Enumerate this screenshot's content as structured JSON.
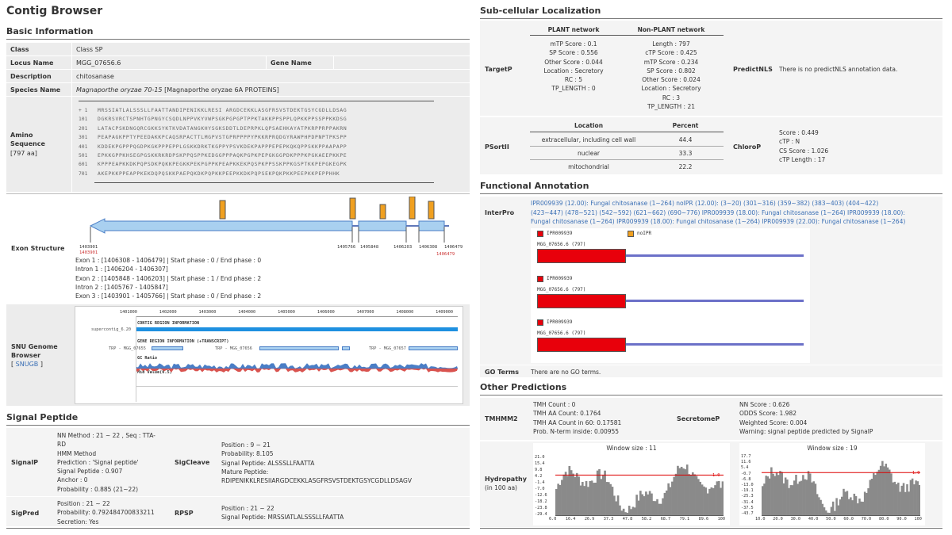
{
  "page_title": "Contig Browser",
  "sections": {
    "basic": "Basic Information",
    "signal": "Signal Peptide",
    "subcell": "Sub-cellular Localization",
    "functional": "Functional Annotation",
    "other": "Other Predictions"
  },
  "basic": {
    "class_label": "Class",
    "class_value": "Class SP",
    "locus_label": "Locus Name",
    "locus_value": "MGG_07656.6",
    "gene_label": "Gene Name",
    "desc_label": "Description",
    "desc_value": "chitosanase",
    "species_label": "Species Name",
    "species_italic": "Magnaporthe oryzae 70-15",
    "species_rest": "[Magnaporthe oryzae 6A PROTEINS]",
    "aa_label": "Amino Sequence",
    "aa_count": "[797 aa]",
    "seq_lines": [
      "MRSSIATLALSSSLLFAATTANDIPENIKKLRESI ARGDCEKKLASGFRSVSTDEKTGSYCGDLLDSAG",
      "DGKRSVRCTSPNHTGPNGYCSQDLNPPVKYVWPSGKPGPGPTPPKTAKKPPSPPLQPKKPPSSPPKKDSG",
      "LATACPSKDNGQRCGKKSYKTKVDATANGKHYSGKSDDTLDEPRPKLQPSAEHKAYATPKRPPRPPAKRN",
      "PEAPAGKPPTYPEEDAKKPCAQSRPACTTLMGPVSTGPRPPPPYPKKRPRQDGYRAWPHPDPNPTPKSPP",
      "KDDEKPGPPPQGDPKGKPPPEPPLGSKKDRKTKGPPYPSVKDEKPAPPPEPEPKQKQPPSKKPPAAPAPP",
      "EPKKGPPKHSEGPGSKKRKRDPSKPPQSPPKEDGGPPPAQKPGPKPEPGKGGPDKPPPKPGKAEEPKKPE",
      "KPPPEAPKKDKPQPSDKPQKKPEGKKPEKPGPPKPEAPKKEKPQSPKPPSSKPPKGSPTKKPEPGKEGPK",
      "AKEPKKPPEAPPKEKDQPQSKKPAEPQKDKPQPKKPEEPKKDKPQPSEKPQKPKKPEEPKKPEPPHHK"
    ],
    "exon_label": "Exon Structure",
    "exon_lines": [
      "Exon 1 : [1406308 - 1406479] | Start phase : 0 / End phase : 0",
      "Intron 1 : [1406204 - 1406307]",
      "Exon 2 : [1405848 - 1406203] | Start phase : 1 / End phase : 2",
      "Intron 2 : [1405767 - 1405847]",
      "Exon 3 : [1403901 - 1405766] | Start phase : 0 / End phase : 2"
    ],
    "exon_ticks": [
      "1403901",
      "1405766",
      "1405848",
      "1406203",
      "1406308",
      "1406479"
    ],
    "snu_label_1": "SNU Genome",
    "snu_label_2": "Browser",
    "snu_link": "SNUGB",
    "snu_ruler": [
      "1401000",
      "1402000",
      "1403000",
      "1404000",
      "1405000",
      "1406000",
      "1407000",
      "1408000",
      "1409000"
    ],
    "snu_contig_head": "CONTIG REGION INFORMATION",
    "snu_supercontig": "supercontig_6.20",
    "snu_gene_head": "GENE REGION INFORMATION (+TRANSCRIPT)",
    "snu_trp": [
      "TRP - MGG_07655",
      "TRP - MGG_07656",
      "TRP - MGG_07657"
    ],
    "snu_gc": "GC Ratio",
    "snu_mid": "Mid Value(0.5)"
  },
  "signal": {
    "signalp_label": "SignalP",
    "signalp_lines": [
      "NN Method : 21 ~ 22 , Seq : TTA-",
      "RD",
      "HMM Method",
      "Prediction : 'Signal peptide'",
      "Signal Peptide : 0.907",
      "Anchor : 0",
      "Probability : 0.885 (21~22)"
    ],
    "sigcleave_label": "SigCleave",
    "sigcleave_lines": [
      "Position : 9 ~ 21",
      "Probability: 8.105",
      "Signal Peptide: ALSSSLLFAATTA",
      "Mature Peptide:",
      "RDIPENIKKLRESIIARGDCEKKLASGFRSVSTDEKTGSYCGDLLDSAGV"
    ],
    "sigpred_label": "SigPred",
    "sigpred_lines": [
      "Position : 21 ~ 22",
      "Probability: 0.792484700833211",
      "Secretion: Yes"
    ],
    "rpsp_label": "RPSP",
    "rpsp_lines": [
      "Position : 21 ~ 22",
      "Signal Peptide: MRSSIATLALSSSLLFAATTA"
    ]
  },
  "subcell": {
    "targetp_label": "TargetP",
    "plant_head": "PLANT network",
    "nonplant_head": "Non-PLANT network",
    "plant_lines": [
      "mTP Score : 0.1",
      "SP Score : 0.556",
      "Other Score : 0.044",
      "Location : Secretory",
      "RC : 5",
      "TP_LENGTH : 0"
    ],
    "nonplant_lines": [
      "Length : 797",
      "cTP Score : 0.425",
      "mTP Score : 0.234",
      "SP Score : 0.802",
      "Other Score : 0.024",
      "Location : Secretory",
      "RC : 3",
      "TP_LENGTH : 21"
    ],
    "predictnls_label": "PredictNLS",
    "predictnls_value": "There is no predictNLS annotation data.",
    "psort_label": "PSortII",
    "psort_head_loc": "Location",
    "psort_head_pct": "Percent",
    "psort_rows": [
      {
        "loc": "extracellular, including cell wall",
        "pct": "44.4"
      },
      {
        "loc": "nuclear",
        "pct": "33.3"
      },
      {
        "loc": "mitochondrial",
        "pct": "22.2"
      }
    ],
    "chlorop_label": "ChloroP",
    "chlorop_lines": [
      "Score : 0.449",
      "cTP : N",
      "CS Score : 1.026",
      "cTP Length : 17"
    ]
  },
  "functional": {
    "interpro_label": "InterPro",
    "interpro_lines": [
      "IPR009939 (12.00): Fungal chitosanase (1~264) noIPR (12.00): (3~20) (301~316) (359~382) (383~403) (404~422)",
      "(423~447) (478~521) (542~592) (621~662) (690~776) IPR009939 (18.00): Fungal chitosanase (1~264) IPR009939 (18.00):",
      "Fungal chitosanase (1~264) IPR009939 (18.00): Fungal chitosanase (1~264) IPR009939 (22.00): Fungal chitosanase (1~264)"
    ],
    "legend_ipr": "IPR009939",
    "legend_noipr": "noIPR",
    "tracks": [
      {
        "legend": "IPR009939",
        "name": "MGG_07656.6 (797)"
      },
      {
        "legend": "IPR009939",
        "name": "MGG_07656.6 (797)"
      },
      {
        "legend": "IPR009939",
        "name": "MGG_07656.6 (797)"
      }
    ],
    "go_label": "GO Terms",
    "go_value": "There are no GO terms."
  },
  "other": {
    "tmhmm_label": "TMHMM2",
    "tmhmm_lines": [
      "TMH Count : 0",
      "TMH AA Count: 0.1764",
      "TMH AA Count in 60: 0.17581",
      "Prob. N-term inside: 0.00955"
    ],
    "secretome_label": "SecretomeP",
    "secretome_lines": [
      "NN Score : 0.626",
      "ODDS Score: 1.982",
      "Weighted Score: 0.004",
      "Warning: signal peptide predicted by SignalP"
    ],
    "hydro_label": "Hydropathy",
    "hydro_sub": "(in 100 aa)",
    "plot1_title": "Window size : 11",
    "plot1_y": [
      "21.0",
      "15.4",
      "9.8",
      "4.2",
      "-1.4",
      "-7.0",
      "-12.6",
      "-18.2",
      "-23.8",
      "-29.4"
    ],
    "plot1_x": [
      "6.0",
      "16.4",
      "26.9",
      "37.3",
      "47.8",
      "58.2",
      "68.7",
      "79.1",
      "89.6",
      "100"
    ],
    "plot1_ref": "1.0",
    "plot2_title": "Window size : 19",
    "plot2_y": [
      "17.7",
      "11.6",
      "5.4",
      "-0.7",
      "-6.8",
      "-13.0",
      "-19.1",
      "-25.3",
      "-31.4",
      "-37.5",
      "-43.7"
    ],
    "plot2_x": [
      "10.0",
      "20.0",
      "30.0",
      "40.0",
      "50.0",
      "60.0",
      "70.0",
      "80.0",
      "90.0",
      "100"
    ],
    "plot2_ref": "1.0"
  }
}
